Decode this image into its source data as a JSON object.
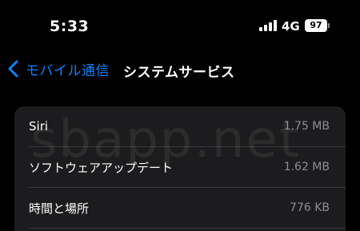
{
  "status_bar": {
    "time": "5:33",
    "network": "4G",
    "battery": "97",
    "signal_icon": "cellular-signal-icon"
  },
  "nav": {
    "back_label": "モバイル通信",
    "back_icon": "chevron-left-icon",
    "title": "システムサービス"
  },
  "watermark": "sbapp.net",
  "rows": [
    {
      "label": "Siri",
      "value": "1.75 MB"
    },
    {
      "label": "ソフトウェアアップデート",
      "value": "1.62 MB"
    },
    {
      "label": "時間と場所",
      "value": "776 KB"
    }
  ],
  "colors": {
    "accent": "#0a84ff",
    "background": "#000000",
    "group_background": "#1c1c1e",
    "secondary_text": "#8e8e93"
  }
}
